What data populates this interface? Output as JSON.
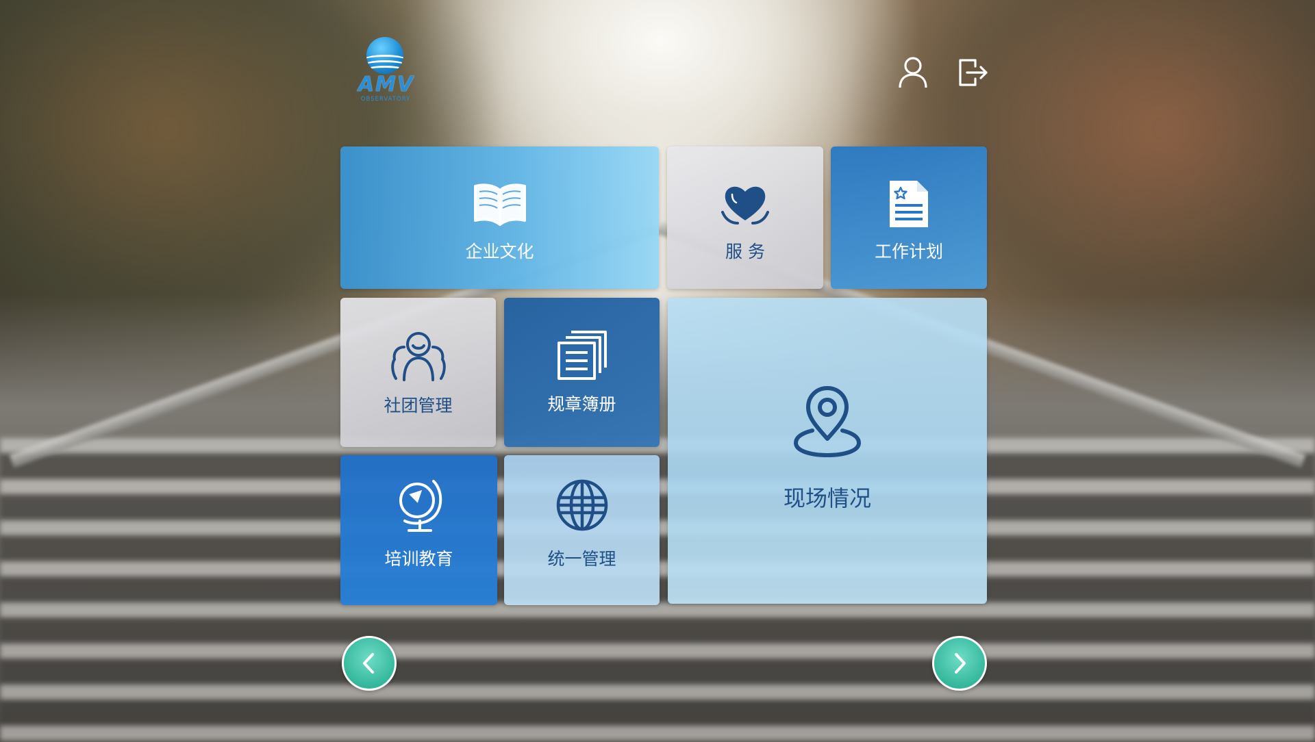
{
  "header": {
    "logo": {
      "title": "AMV",
      "subtitle": "OBSERVATORY",
      "color": "#2a8ed8"
    },
    "user_icon": "user-icon",
    "logout_icon": "logout-icon"
  },
  "tiles": [
    {
      "label": "企业文化",
      "icon": "open-book-icon"
    },
    {
      "label": "服 务",
      "icon": "heart-hands-icon"
    },
    {
      "label": "工作计划",
      "icon": "document-star-icon"
    },
    {
      "label": "社团管理",
      "icon": "group-icon"
    },
    {
      "label": "规章簿册",
      "icon": "stacked-documents-icon"
    },
    {
      "label": "现场情况",
      "icon": "location-pin-icon"
    },
    {
      "label": "培训教育",
      "icon": "globe-icon"
    },
    {
      "label": "统一管理",
      "icon": "world-grid-icon"
    }
  ],
  "navigation": {
    "prev_icon": "chevron-left-icon",
    "next_icon": "chevron-right-icon",
    "accent": "#34b89c"
  },
  "colors": {
    "tile_dark_text": "#1f4f86",
    "tile_light_text": "#ffffff"
  }
}
